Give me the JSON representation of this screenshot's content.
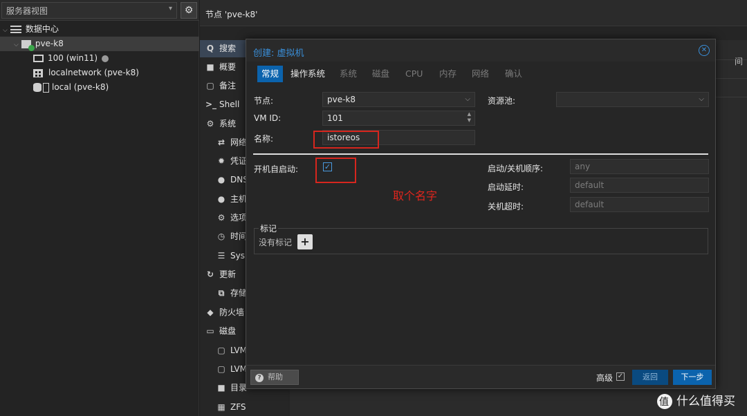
{
  "tree": {
    "view_label": "服务器视图",
    "items": [
      {
        "label": "数据中心"
      },
      {
        "label": "pve-k8"
      },
      {
        "label": "100 (win11)"
      },
      {
        "label": "localnetwork (pve-k8)"
      },
      {
        "label": "local (pve-k8)"
      }
    ]
  },
  "main": {
    "title": "节点 'pve-k8'",
    "nav": [
      {
        "label": "搜索",
        "icon": "search-icon"
      },
      {
        "label": "概要",
        "icon": "book-icon"
      },
      {
        "label": "备注",
        "icon": "note-icon"
      },
      {
        "label": "Shell",
        "icon": "terminal-icon"
      },
      {
        "label": "系统",
        "icon": "gears-icon"
      },
      {
        "label": "网络",
        "icon": "exchange-icon"
      },
      {
        "label": "凭证",
        "icon": "certificate-icon"
      },
      {
        "label": "DNS",
        "icon": "globe-icon"
      },
      {
        "label": "主机",
        "icon": "globe-icon"
      },
      {
        "label": "选项",
        "icon": "gear-icon"
      },
      {
        "label": "时间",
        "icon": "clock-icon"
      },
      {
        "label": "Sys",
        "icon": "list-icon"
      },
      {
        "label": "更新",
        "icon": "refresh-icon"
      },
      {
        "label": "存储",
        "icon": "copy-icon"
      },
      {
        "label": "防火墙",
        "icon": "shield-icon"
      },
      {
        "label": "磁盘",
        "icon": "hdd-icon"
      },
      {
        "label": "LVM",
        "icon": "square-icon"
      },
      {
        "label": "LVM",
        "icon": "square-icon"
      },
      {
        "label": "目录",
        "icon": "folder-icon"
      },
      {
        "label": "ZFS",
        "icon": "grid-icon"
      }
    ],
    "bg_hint": "间"
  },
  "dialog": {
    "title": "创建: 虚拟机",
    "tabs": [
      {
        "label": "常规",
        "state": "active"
      },
      {
        "label": "操作系统",
        "state": "enabled"
      },
      {
        "label": "系统",
        "state": "disabled"
      },
      {
        "label": "磁盘",
        "state": "disabled"
      },
      {
        "label": "CPU",
        "state": "disabled"
      },
      {
        "label": "内存",
        "state": "disabled"
      },
      {
        "label": "网络",
        "state": "disabled"
      },
      {
        "label": "确认",
        "state": "disabled"
      }
    ],
    "form": {
      "node_label": "节点:",
      "node_value": "pve-k8",
      "vmid_label": "VM ID:",
      "vmid_value": "101",
      "name_label": "名称:",
      "name_value": "istoreos",
      "pool_label": "资源池:",
      "pool_value": "",
      "onboot_label": "开机自启动:",
      "onboot_checked": true,
      "order_label": "启动/关机顺序:",
      "order_placeholder": "any",
      "delay_label": "启动延时:",
      "delay_placeholder": "default",
      "shutdown_label": "关机超时:",
      "shutdown_placeholder": "default",
      "tags_legend": "标记",
      "tags_empty": "没有标记",
      "add_tag": "+"
    },
    "annotation": "取个名字",
    "footer": {
      "help": "帮助",
      "advanced": "高级",
      "advanced_checked": true,
      "back": "返回",
      "next": "下一步"
    }
  },
  "watermark": "什么值得买",
  "colors": {
    "accent": "#0b63ad",
    "title_blue": "#3a8fd9",
    "annotation_red": "#d7261e",
    "online_green": "#3aa64a"
  }
}
